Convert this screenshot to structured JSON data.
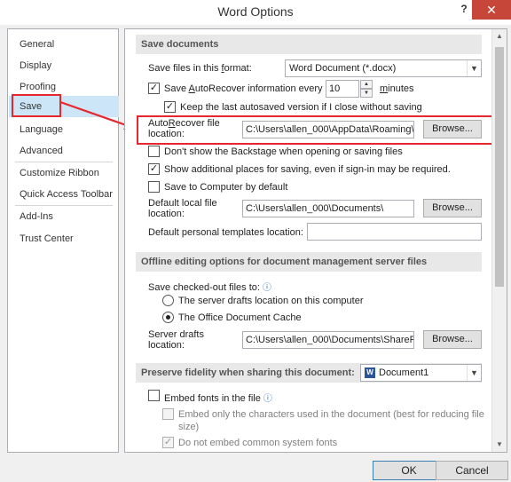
{
  "window": {
    "title": "Word Options",
    "help_label": "?",
    "close_label": "✕"
  },
  "sidebar": {
    "items": [
      {
        "label": "General"
      },
      {
        "label": "Display"
      },
      {
        "label": "Proofing"
      },
      {
        "label": "Save"
      },
      {
        "label": "Language"
      },
      {
        "label": "Advanced"
      },
      {
        "label": "Customize Ribbon"
      },
      {
        "label": "Quick Access Toolbar"
      },
      {
        "label": "Add-Ins"
      },
      {
        "label": "Trust Center"
      }
    ],
    "selected": "Save"
  },
  "save_documents": {
    "header": "Save documents",
    "format_label_pre": "Save files in this ",
    "format_label_u": "f",
    "format_label_post": "ormat:",
    "format_value": "Word Document (*.docx)",
    "autorecover_pre": "Save ",
    "autorecover_u": "A",
    "autorecover_post": "utoRecover information every",
    "autorecover_checked": true,
    "autorecover_minutes": "10",
    "minutes_u": "m",
    "minutes_post": "inutes",
    "keep_last_label": "Keep the last autosaved version if I close without saving",
    "keep_last_checked": true,
    "autorecover_loc_line1_pre": "Auto",
    "autorecover_loc_line1_u": "R",
    "autorecover_loc_line1_post": "ecover file",
    "autorecover_loc_line2": "location:",
    "autorecover_loc_value": "C:\\Users\\allen_000\\AppData\\Roaming\\M",
    "browse_label": "Browse...",
    "dont_show_label": "Don't show the Backstage when opening or saving files",
    "dont_show_checked": false,
    "show_places_label": "Show additional places for saving, even if sign-in may be required.",
    "show_places_checked": true,
    "save_computer_label": "Save to Computer by default",
    "save_computer_checked": false,
    "default_local_line1": "Default local file",
    "default_local_line2": "location:",
    "default_local_value": "C:\\Users\\allen_000\\Documents\\",
    "default_personal_label": "Default personal templates location:",
    "default_personal_value": ""
  },
  "offline": {
    "header": "Offline editing options for document management server files",
    "checked_out_label": "Save checked-out files to:",
    "server_drafts_label": "The server drafts location on this computer",
    "office_cache_label": "The Office Document Cache",
    "selected_option": "office_cache",
    "server_drafts_line1": "Server drafts",
    "server_drafts_line2": "location:",
    "server_drafts_value": "C:\\Users\\allen_000\\Documents\\SharePo",
    "browse_label": "Browse..."
  },
  "fidelity": {
    "header": "Preserve fidelity when sharing this document:",
    "document_value": "Document1",
    "embed_fonts_label": "Embed fonts in the file",
    "embed_fonts_checked": false,
    "embed_only_line1": "Embed only the characters used in the document (best for reducing file",
    "embed_only_line2": "size)",
    "embed_only_checked": false,
    "no_common_label": "Do not embed common system fonts",
    "no_common_checked": true
  },
  "footer": {
    "ok_label": "OK",
    "cancel_label": "Cancel"
  },
  "colors": {
    "highlight": "#e8262e",
    "selection": "#cde6f7",
    "close": "#c7463a"
  }
}
